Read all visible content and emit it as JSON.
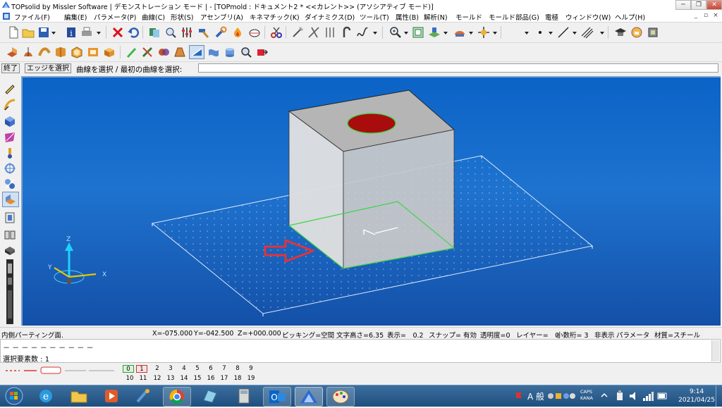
{
  "window": {
    "title": "TOPsolid by Missler Software | デモンストレーション モード | - [TOPmold : ドキュメント2 *  <<カレント>> (アソシアティブ モード)]",
    "icon": "topsolid-app-icon"
  },
  "menu": [
    "ファイル(F)",
    "編集(E)",
    "パラメータ(P)",
    "曲線(C)",
    "形状(S)",
    "アセンブリ(A)",
    "キネマチック(K)",
    "ダイナミクス(D)",
    "ツール(T)",
    "属性(B)",
    "解析(N)",
    "モールド",
    "モールド部品(G)",
    "電極",
    "ウィンドウ(W)",
    "ヘルプ(H)"
  ],
  "colors": {
    "viewport_top": "#0b63c6",
    "viewport_bottom": "#1450a8",
    "current_color": "#e8001a",
    "edge_highlight": "#3fd24a",
    "hole_fill": "#a80c0c"
  },
  "command": {
    "end_label": "終了",
    "edge_select_label": "エッジを選択",
    "prompt": "曲線を選択 / 最初の曲線を選択:",
    "input_value": ""
  },
  "viewport": {
    "axis_labels": {
      "z": "Z",
      "y": "Y",
      "x": "X"
    },
    "icons": [
      "cube-3d-model",
      "hole-top-face",
      "work-plane-grid",
      "red-arrow-pointer",
      "coordinate-triad"
    ]
  },
  "status": {
    "message": "内側パーティング面.",
    "x": "X=-075.000",
    "y": "Y=-042.500",
    "z": "Z=+000.000",
    "picking": "ピッキング=空間",
    "text_height": "文字高さ=6.35",
    "display": "表示=　0.2",
    "snap": "スナップ= 有効",
    "transparency": "透明度=0",
    "layer": "レイヤー=　0",
    "decimals": "小数桁= 3",
    "hidden": "非表示",
    "parameter": "パラメータ",
    "material": "材質=スチール"
  },
  "console": {
    "line1": "－ － － － － － － － － －",
    "line2": "選択要素数 : 1"
  },
  "layers": {
    "top": [
      "0",
      "1",
      "2",
      "3",
      "4",
      "5",
      "6",
      "7",
      "8",
      "9"
    ],
    "bottom": [
      "10",
      "11",
      "12",
      "13",
      "14",
      "15",
      "16",
      "17",
      "18",
      "19"
    ]
  },
  "taskbar": {
    "apps": [
      "windows-start",
      "internet-explorer",
      "file-explorer",
      "media-player",
      "paint-brush",
      "chrome",
      "notes",
      "calculator",
      "outlook",
      "topsolid",
      "paint"
    ],
    "ime": "A 般",
    "caps": "CAPS",
    "kana": "KANA",
    "time": "9:14",
    "date": "2021/04/25"
  }
}
